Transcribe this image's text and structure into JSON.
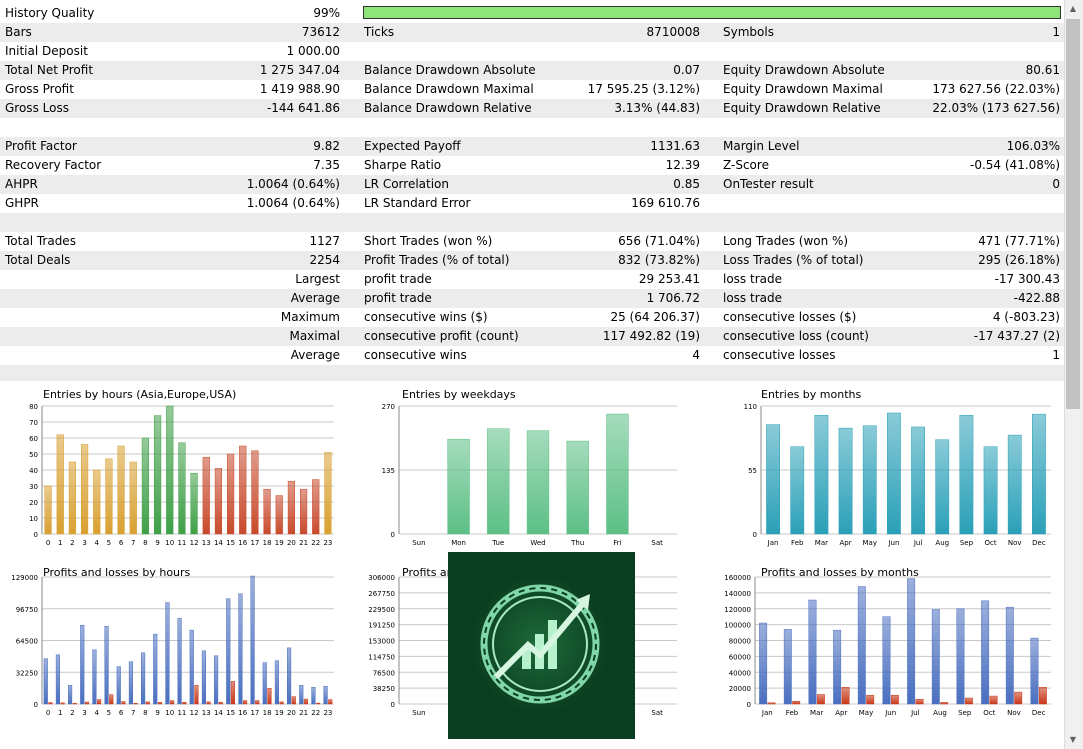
{
  "history_quality": {
    "label": "History Quality",
    "value": "99%",
    "fraction": 0.99,
    "bar_color": "#8ee67a"
  },
  "rows": [
    {
      "shade": true,
      "c1": [
        "Bars",
        "73612"
      ],
      "c2": [
        "Ticks",
        "8710008"
      ],
      "c3": [
        "Symbols",
        "1"
      ]
    },
    {
      "shade": false,
      "c1": [
        "Initial Deposit",
        "1 000.00"
      ],
      "c2": [
        "",
        ""
      ],
      "c3": [
        "",
        ""
      ]
    },
    {
      "shade": true,
      "c1": [
        "Total Net Profit",
        "1 275 347.04"
      ],
      "c2": [
        "Balance Drawdown Absolute",
        "0.07"
      ],
      "c3": [
        "Equity Drawdown Absolute",
        "80.61"
      ]
    },
    {
      "shade": false,
      "c1": [
        "Gross Profit",
        "1 419 988.90"
      ],
      "c2": [
        "Balance Drawdown Maximal",
        "17 595.25 (3.12%)"
      ],
      "c3": [
        "Equity Drawdown Maximal",
        "173 627.56 (22.03%)"
      ]
    },
    {
      "shade": true,
      "c1": [
        "Gross Loss",
        "-144 641.86"
      ],
      "c2": [
        "Balance Drawdown Relative",
        "3.13% (44.83)"
      ],
      "c3": [
        "Equity Drawdown Relative",
        "22.03% (173 627.56)"
      ]
    },
    {
      "shade": false,
      "c1": [
        "",
        ""
      ],
      "c2": [
        "",
        ""
      ],
      "c3": [
        "",
        ""
      ]
    },
    {
      "shade": true,
      "c1": [
        "Profit Factor",
        "9.82"
      ],
      "c2": [
        "Expected Payoff",
        "1131.63"
      ],
      "c3": [
        "Margin Level",
        "106.03%"
      ]
    },
    {
      "shade": false,
      "c1": [
        "Recovery Factor",
        "7.35"
      ],
      "c2": [
        "Sharpe Ratio",
        "12.39"
      ],
      "c3": [
        "Z-Score",
        "-0.54 (41.08%)"
      ]
    },
    {
      "shade": true,
      "c1": [
        "AHPR",
        "1.0064 (0.64%)"
      ],
      "c2": [
        "LR Correlation",
        "0.85"
      ],
      "c3": [
        "OnTester result",
        "0"
      ]
    },
    {
      "shade": false,
      "c1": [
        "GHPR",
        "1.0064 (0.64%)"
      ],
      "c2": [
        "LR Standard Error",
        "169 610.76"
      ],
      "c3": [
        "",
        ""
      ]
    },
    {
      "shade": true,
      "c1": [
        "",
        ""
      ],
      "c2": [
        "",
        ""
      ],
      "c3": [
        "",
        ""
      ]
    },
    {
      "shade": false,
      "c1": [
        "Total Trades",
        "1127"
      ],
      "c2": [
        "Short Trades (won %)",
        "656 (71.04%)"
      ],
      "c3": [
        "Long Trades (won %)",
        "471 (77.71%)"
      ]
    },
    {
      "shade": true,
      "c1": [
        "Total Deals",
        "2254"
      ],
      "c2": [
        "Profit Trades (% of total)",
        "832 (73.82%)"
      ],
      "c3": [
        "Loss Trades (% of total)",
        "295 (26.18%)"
      ]
    },
    {
      "shade": false,
      "c1r": "Largest",
      "c2": [
        "profit trade",
        "29 253.41"
      ],
      "c3": [
        "loss trade",
        "-17 300.43"
      ]
    },
    {
      "shade": true,
      "c1r": "Average",
      "c2": [
        "profit trade",
        "1 706.72"
      ],
      "c3": [
        "loss trade",
        "-422.88"
      ]
    },
    {
      "shade": false,
      "c1r": "Maximum",
      "c2": [
        "consecutive wins ($)",
        "25 (64 206.37)"
      ],
      "c3": [
        "consecutive losses ($)",
        "4 (-803.23)"
      ]
    },
    {
      "shade": true,
      "c1r": "Maximal",
      "c2": [
        "consecutive profit (count)",
        "117 492.82 (19)"
      ],
      "c3": [
        "consecutive loss (count)",
        "-17 437.27 (2)"
      ]
    },
    {
      "shade": false,
      "c1r": "Average",
      "c2": [
        "consecutive wins",
        "4"
      ],
      "c3": [
        "consecutive losses",
        "1"
      ]
    },
    {
      "shade": true,
      "c1": [
        "",
        ""
      ],
      "c2": [
        "",
        ""
      ],
      "c3": [
        "",
        ""
      ]
    }
  ],
  "colors": {
    "hour_asia": "#d9a030",
    "hour_europe": "#3fa048",
    "hour_usa": "#c84a2c",
    "weekday": "#5cbf86",
    "month": "#2aa0b8",
    "profit": "#4a6fc0",
    "loss": "#c83818"
  },
  "chart_data": [
    {
      "id": "entries-hours",
      "type": "bar",
      "title": "Entries by hours (Asia,Europe,USA)",
      "categories": [
        "0",
        "1",
        "2",
        "3",
        "4",
        "5",
        "6",
        "7",
        "8",
        "9",
        "10",
        "11",
        "12",
        "13",
        "14",
        "15",
        "16",
        "17",
        "18",
        "19",
        "20",
        "21",
        "22",
        "23"
      ],
      "values": [
        30,
        62,
        45,
        56,
        40,
        47,
        55,
        45,
        60,
        74,
        80,
        57,
        38,
        48,
        41,
        50,
        55,
        52,
        28,
        24,
        33,
        28,
        34,
        51
      ],
      "ylim": [
        0,
        80
      ],
      "yticks": [
        "0",
        "10",
        "20",
        "30",
        "40",
        "50",
        "60",
        "70",
        "80"
      ]
    },
    {
      "id": "entries-weekdays",
      "type": "bar",
      "title": "Entries by weekdays",
      "categories": [
        "Sun",
        "Mon",
        "Tue",
        "Wed",
        "Thu",
        "Fri",
        "Sat"
      ],
      "values": [
        0,
        200,
        222,
        218,
        196,
        253,
        0
      ],
      "ylim": [
        0,
        270
      ],
      "yticks": [
        "0",
        "135",
        "270"
      ]
    },
    {
      "id": "entries-months",
      "type": "bar",
      "title": "Entries by months",
      "categories": [
        "Jan",
        "Feb",
        "Mar",
        "Apr",
        "May",
        "Jun",
        "Jul",
        "Aug",
        "Sep",
        "Oct",
        "Nov",
        "Dec"
      ],
      "values": [
        94,
        75,
        102,
        91,
        93,
        104,
        92,
        81,
        102,
        75,
        85,
        103
      ],
      "ylim": [
        0,
        110
      ],
      "yticks": [
        "0",
        "55",
        "110"
      ]
    },
    {
      "id": "pl-hours",
      "type": "bar",
      "title": "Profits and losses by hours",
      "categories": [
        "0",
        "1",
        "2",
        "3",
        "4",
        "5",
        "6",
        "7",
        "8",
        "9",
        "10",
        "11",
        "12",
        "13",
        "14",
        "15",
        "16",
        "17",
        "18",
        "19",
        "20",
        "21",
        "22",
        "23"
      ],
      "series": [
        {
          "values": [
            46000,
            50000,
            19000,
            80000,
            55000,
            79000,
            38000,
            43000,
            52000,
            71000,
            103000,
            87000,
            75000,
            54000,
            49000,
            107000,
            112000,
            130000,
            42000,
            44000,
            57000,
            19000,
            17000,
            18000
          ]
        },
        {
          "values": [
            1500,
            1200,
            700,
            2000,
            4500,
            9500,
            2500,
            700,
            2200,
            1700,
            3500,
            1800,
            19000,
            2200,
            1800,
            23000,
            3500,
            3500,
            16000,
            2200,
            7500,
            5000,
            900,
            4500
          ]
        }
      ],
      "ylim": [
        0,
        129000
      ],
      "yticks": [
        "0",
        "32250",
        "64500",
        "96750",
        "129000"
      ]
    },
    {
      "id": "pl-weekdays",
      "type": "bar",
      "title": "Profits and losses by weekdays",
      "categories": [
        "Sun",
        "Mon",
        "Tue",
        "Wed",
        "Thu",
        "Fri",
        "Sat"
      ],
      "ylim": [
        0,
        306000
      ],
      "yticks": [
        "0",
        "38250",
        "76500",
        "114750",
        "153000",
        "191250",
        "229500",
        "267750",
        "306000"
      ]
    },
    {
      "id": "pl-months",
      "type": "bar",
      "title": "Profits and losses by months",
      "categories": [
        "Jan",
        "Feb",
        "Mar",
        "Apr",
        "May",
        "Jun",
        "Jul",
        "Aug",
        "Sep",
        "Oct",
        "Nov",
        "Dec"
      ],
      "series": [
        {
          "values": [
            102000,
            94000,
            131000,
            93000,
            148000,
            110000,
            158000,
            119000,
            120000,
            130000,
            122000,
            83000
          ]
        },
        {
          "values": [
            1500,
            3500,
            12000,
            21000,
            11000,
            11000,
            6000,
            2000,
            7500,
            10000,
            15000,
            21000
          ]
        }
      ],
      "ylim": [
        0,
        160000
      ],
      "yticks": [
        "0",
        "20000",
        "40000",
        "60000",
        "80000",
        "100000",
        "120000",
        "140000",
        "160000"
      ]
    }
  ]
}
